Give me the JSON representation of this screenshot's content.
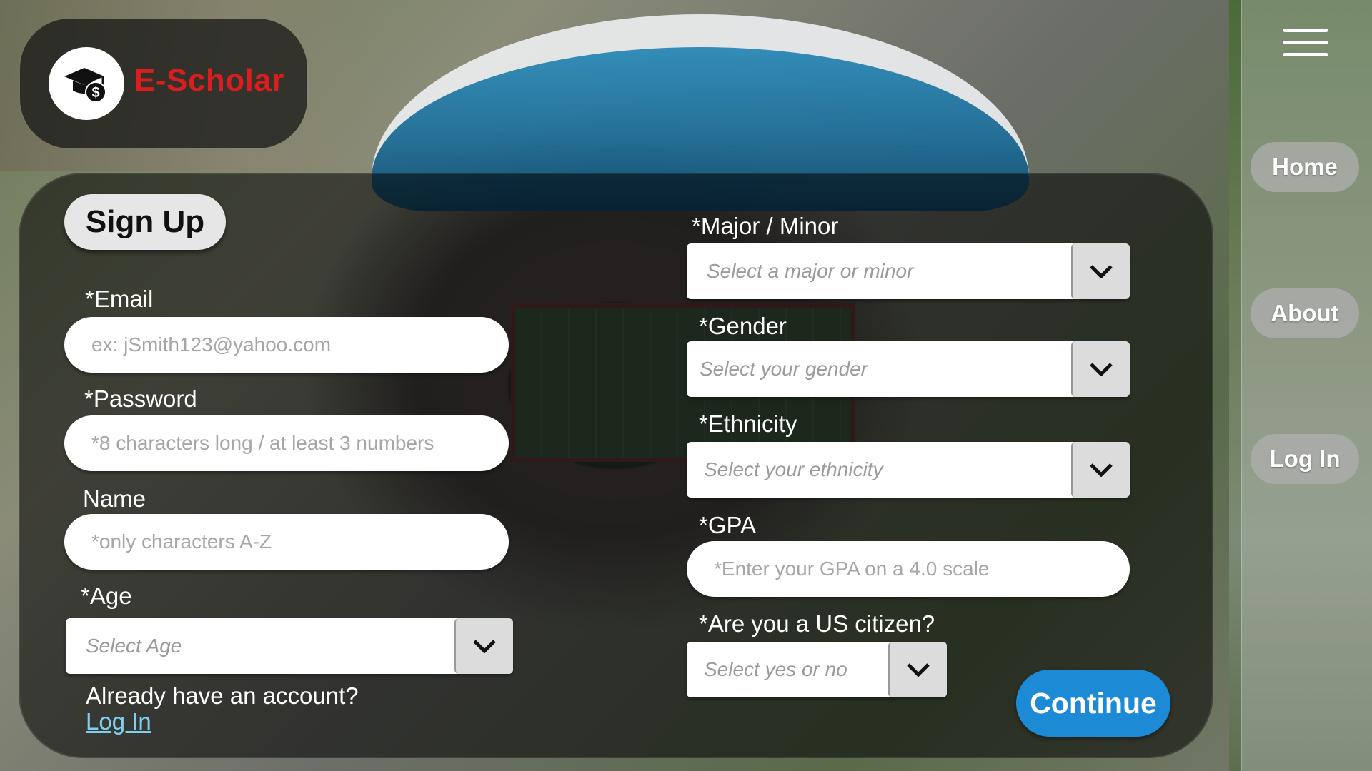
{
  "brand": {
    "name": "E-Scholar",
    "accent_color": "#d81e1e",
    "logo_icon": "graduation-cap-dollar-icon"
  },
  "nav": {
    "menu_icon": "hamburger-menu-icon",
    "items": [
      {
        "label": "Home"
      },
      {
        "label": "About"
      },
      {
        "label": "Log In"
      }
    ]
  },
  "form": {
    "title": "Sign Up",
    "email": {
      "label": "*Email",
      "placeholder": "ex: jSmith123@yahoo.com"
    },
    "password": {
      "label": "*Password",
      "placeholder": "*8 characters long / at least 3 numbers"
    },
    "name": {
      "label": "Name",
      "placeholder": "*only characters A-Z"
    },
    "age": {
      "label": "*Age",
      "placeholder": "Select Age"
    },
    "major": {
      "label": "*Major / Minor",
      "placeholder": "Select a major or minor"
    },
    "gender": {
      "label": "*Gender",
      "placeholder": "Select your gender"
    },
    "ethnicity": {
      "label": "*Ethnicity",
      "placeholder": "Select your ethnicity"
    },
    "gpa": {
      "label": "*GPA",
      "placeholder": "*Enter your GPA on a 4.0 scale"
    },
    "citizen": {
      "label": "*Are you a US citizen?",
      "placeholder": "Select yes or no"
    },
    "already_text": "Already have an account?",
    "login_link": "Log In",
    "continue_label": "Continue",
    "continue_color": "#1d8ad6"
  }
}
